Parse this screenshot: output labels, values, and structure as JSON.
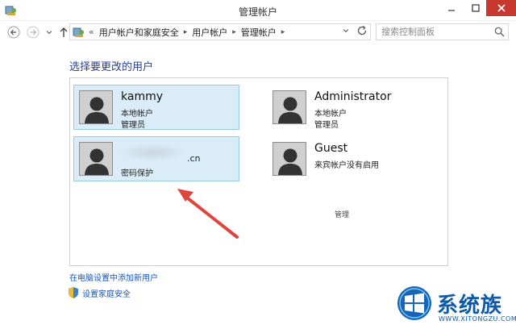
{
  "window": {
    "title": "管理帐户"
  },
  "nav": {
    "overflow": "«",
    "breadcrumbs": [
      "用户帐户和家庭安全",
      "用户帐户",
      "管理帐户"
    ],
    "search_placeholder": "搜索控制面板"
  },
  "main": {
    "heading": "选择要更改的用户",
    "accounts": [
      {
        "name": "kammy",
        "type": "本地帐户",
        "role": "管理员",
        "selected": true
      },
      {
        "name": "Administrator",
        "type": "本地帐户",
        "role": "管理员",
        "selected": false
      },
      {
        "name_suffix": ".cn",
        "role": "密码保护",
        "selected": true
      },
      {
        "name": "Guest",
        "role": "来宾帐户没有启用",
        "selected": false
      }
    ],
    "stray_text": "管理",
    "links": {
      "add_user": "在电脑设置中添加新用户",
      "family_safety": "设置家庭安全"
    }
  },
  "watermark": {
    "brand": "系统族",
    "url": "WWW.XITONGZU.COM"
  },
  "colors": {
    "accent_close": "#c7382f",
    "heading_blue": "#2a3f8f",
    "link_blue": "#1a56b8",
    "selected_bg": "#d9ecf7",
    "arrow_red": "#e0453c"
  }
}
